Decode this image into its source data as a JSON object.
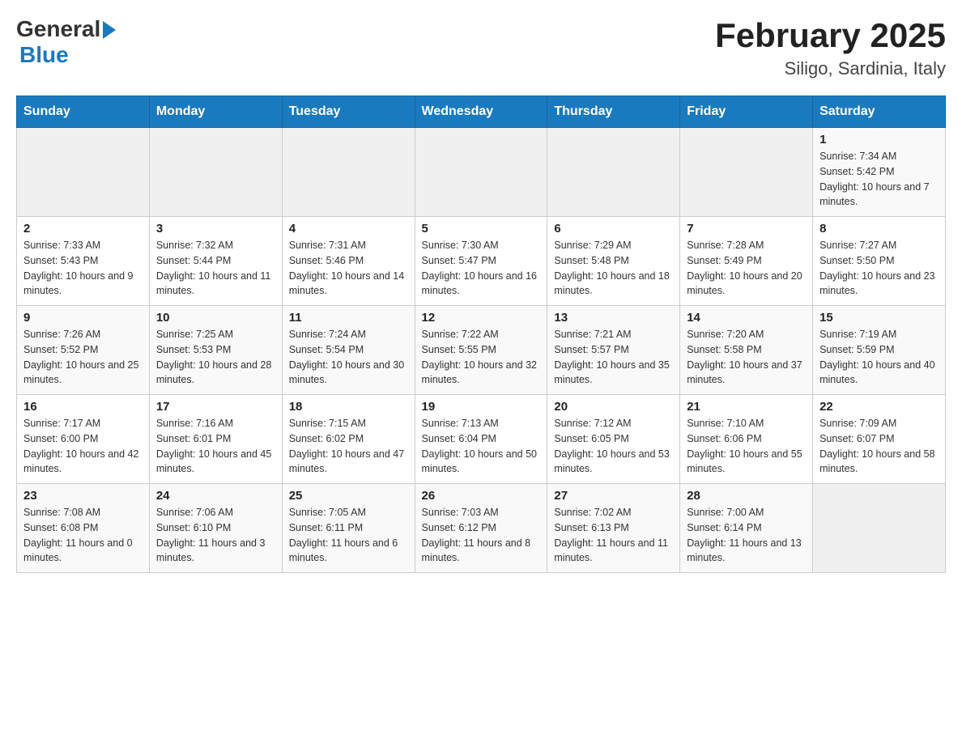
{
  "header": {
    "logo_general": "General",
    "logo_blue": "Blue",
    "title": "February 2025",
    "location": "Siligo, Sardinia, Italy"
  },
  "days_of_week": [
    "Sunday",
    "Monday",
    "Tuesday",
    "Wednesday",
    "Thursday",
    "Friday",
    "Saturday"
  ],
  "weeks": [
    [
      {
        "day": "",
        "info": ""
      },
      {
        "day": "",
        "info": ""
      },
      {
        "day": "",
        "info": ""
      },
      {
        "day": "",
        "info": ""
      },
      {
        "day": "",
        "info": ""
      },
      {
        "day": "",
        "info": ""
      },
      {
        "day": "1",
        "info": "Sunrise: 7:34 AM\nSunset: 5:42 PM\nDaylight: 10 hours and 7 minutes."
      }
    ],
    [
      {
        "day": "2",
        "info": "Sunrise: 7:33 AM\nSunset: 5:43 PM\nDaylight: 10 hours and 9 minutes."
      },
      {
        "day": "3",
        "info": "Sunrise: 7:32 AM\nSunset: 5:44 PM\nDaylight: 10 hours and 11 minutes."
      },
      {
        "day": "4",
        "info": "Sunrise: 7:31 AM\nSunset: 5:46 PM\nDaylight: 10 hours and 14 minutes."
      },
      {
        "day": "5",
        "info": "Sunrise: 7:30 AM\nSunset: 5:47 PM\nDaylight: 10 hours and 16 minutes."
      },
      {
        "day": "6",
        "info": "Sunrise: 7:29 AM\nSunset: 5:48 PM\nDaylight: 10 hours and 18 minutes."
      },
      {
        "day": "7",
        "info": "Sunrise: 7:28 AM\nSunset: 5:49 PM\nDaylight: 10 hours and 20 minutes."
      },
      {
        "day": "8",
        "info": "Sunrise: 7:27 AM\nSunset: 5:50 PM\nDaylight: 10 hours and 23 minutes."
      }
    ],
    [
      {
        "day": "9",
        "info": "Sunrise: 7:26 AM\nSunset: 5:52 PM\nDaylight: 10 hours and 25 minutes."
      },
      {
        "day": "10",
        "info": "Sunrise: 7:25 AM\nSunset: 5:53 PM\nDaylight: 10 hours and 28 minutes."
      },
      {
        "day": "11",
        "info": "Sunrise: 7:24 AM\nSunset: 5:54 PM\nDaylight: 10 hours and 30 minutes."
      },
      {
        "day": "12",
        "info": "Sunrise: 7:22 AM\nSunset: 5:55 PM\nDaylight: 10 hours and 32 minutes."
      },
      {
        "day": "13",
        "info": "Sunrise: 7:21 AM\nSunset: 5:57 PM\nDaylight: 10 hours and 35 minutes."
      },
      {
        "day": "14",
        "info": "Sunrise: 7:20 AM\nSunset: 5:58 PM\nDaylight: 10 hours and 37 minutes."
      },
      {
        "day": "15",
        "info": "Sunrise: 7:19 AM\nSunset: 5:59 PM\nDaylight: 10 hours and 40 minutes."
      }
    ],
    [
      {
        "day": "16",
        "info": "Sunrise: 7:17 AM\nSunset: 6:00 PM\nDaylight: 10 hours and 42 minutes."
      },
      {
        "day": "17",
        "info": "Sunrise: 7:16 AM\nSunset: 6:01 PM\nDaylight: 10 hours and 45 minutes."
      },
      {
        "day": "18",
        "info": "Sunrise: 7:15 AM\nSunset: 6:02 PM\nDaylight: 10 hours and 47 minutes."
      },
      {
        "day": "19",
        "info": "Sunrise: 7:13 AM\nSunset: 6:04 PM\nDaylight: 10 hours and 50 minutes."
      },
      {
        "day": "20",
        "info": "Sunrise: 7:12 AM\nSunset: 6:05 PM\nDaylight: 10 hours and 53 minutes."
      },
      {
        "day": "21",
        "info": "Sunrise: 7:10 AM\nSunset: 6:06 PM\nDaylight: 10 hours and 55 minutes."
      },
      {
        "day": "22",
        "info": "Sunrise: 7:09 AM\nSunset: 6:07 PM\nDaylight: 10 hours and 58 minutes."
      }
    ],
    [
      {
        "day": "23",
        "info": "Sunrise: 7:08 AM\nSunset: 6:08 PM\nDaylight: 11 hours and 0 minutes."
      },
      {
        "day": "24",
        "info": "Sunrise: 7:06 AM\nSunset: 6:10 PM\nDaylight: 11 hours and 3 minutes."
      },
      {
        "day": "25",
        "info": "Sunrise: 7:05 AM\nSunset: 6:11 PM\nDaylight: 11 hours and 6 minutes."
      },
      {
        "day": "26",
        "info": "Sunrise: 7:03 AM\nSunset: 6:12 PM\nDaylight: 11 hours and 8 minutes."
      },
      {
        "day": "27",
        "info": "Sunrise: 7:02 AM\nSunset: 6:13 PM\nDaylight: 11 hours and 11 minutes."
      },
      {
        "day": "28",
        "info": "Sunrise: 7:00 AM\nSunset: 6:14 PM\nDaylight: 11 hours and 13 minutes."
      },
      {
        "day": "",
        "info": ""
      }
    ]
  ]
}
